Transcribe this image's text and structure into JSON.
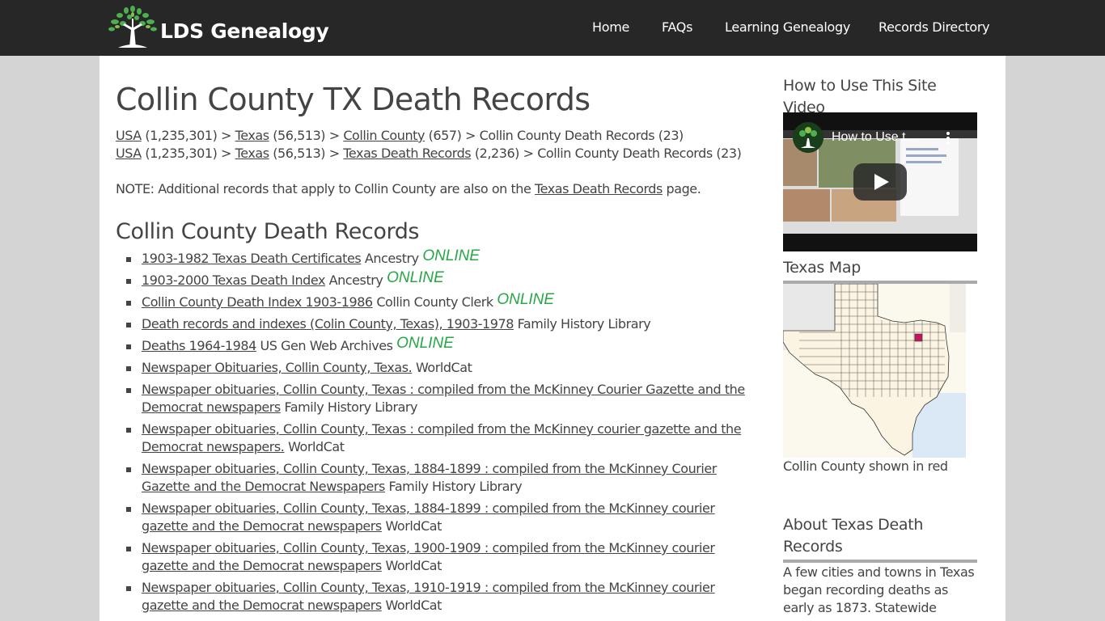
{
  "header": {
    "logo_text": "LDS Genealogy",
    "nav": [
      {
        "label": "Home"
      },
      {
        "label": "FAQs"
      },
      {
        "label": "Learning Genealogy"
      },
      {
        "label": "Records Directory"
      }
    ]
  },
  "main": {
    "title": "Collin County TX Death Records",
    "breadcrumbs": [
      [
        {
          "type": "link",
          "text": "USA"
        },
        {
          "type": "text",
          "text": " (1,235,301) > "
        },
        {
          "type": "link",
          "text": "Texas"
        },
        {
          "type": "text",
          "text": " (56,513) > "
        },
        {
          "type": "link",
          "text": "Collin County"
        },
        {
          "type": "text",
          "text": " (657) > Collin County Death Records (23)"
        }
      ],
      [
        {
          "type": "link",
          "text": "USA"
        },
        {
          "type": "text",
          "text": " (1,235,301) > "
        },
        {
          "type": "link",
          "text": "Texas"
        },
        {
          "type": "text",
          "text": " (56,513) > "
        },
        {
          "type": "link",
          "text": "Texas Death Records"
        },
        {
          "type": "text",
          "text": " (2,236) > Collin County Death Records (23)"
        }
      ]
    ],
    "note": {
      "prefix": "NOTE: Additional records that apply to Collin County are also on the ",
      "link": "Texas Death Records",
      "suffix": " page."
    },
    "section_title": "Collin County Death Records",
    "online_label": "ONLINE",
    "records": [
      {
        "title": "1903-1982 Texas Death Certificates",
        "source": "Ancestry",
        "online": true
      },
      {
        "title": "1903-2000 Texas Death Index",
        "source": "Ancestry",
        "online": true
      },
      {
        "title": "Collin County Death Index 1903-1986",
        "source": "Collin County Clerk",
        "online": true
      },
      {
        "title": "Death records and indexes (Colin County, Texas), 1903-1978",
        "source": "Family History Library",
        "online": false
      },
      {
        "title": "Deaths 1964-1984",
        "source": "US Gen Web Archives",
        "online": true
      },
      {
        "title": "Newspaper Obituaries, Collin County, Texas.",
        "source": "WorldCat",
        "online": false
      },
      {
        "title": "Newspaper obituaries, Collin County, Texas : compiled from the McKinney Courier Gazette and the Democrat newspapers",
        "source": "Family History Library",
        "online": false
      },
      {
        "title": "Newspaper obituaries, Collin County, Texas : compiled from the McKinney courier gazette and the Democrat newspapers.",
        "source": "WorldCat",
        "online": false
      },
      {
        "title": "Newspaper obituaries, Collin County, Texas, 1884-1899 : compiled from the McKinney Courier Gazette and the Democrat Newspapers",
        "source": "Family History Library",
        "online": false
      },
      {
        "title": "Newspaper obituaries, Collin County, Texas, 1884-1899 : compiled from the McKinney courier gazette and the Democrat newspapers",
        "source": "WorldCat",
        "online": false
      },
      {
        "title": "Newspaper obituaries, Collin County, Texas, 1900-1909 : compiled from the McKinney courier gazette and the Democrat newspapers",
        "source": "WorldCat",
        "online": false
      },
      {
        "title": "Newspaper obituaries, Collin County, Texas, 1910-1919 : compiled from the McKinney courier gazette and the Democrat newspapers",
        "source": "WorldCat",
        "online": false
      }
    ]
  },
  "sidebar": {
    "video_heading": "How to Use This Site Video",
    "video_title": "How to Use t...",
    "map_heading": "Texas Map",
    "map_caption": "Collin County shown in red",
    "about_heading": "About Texas Death Records",
    "about_text": "A few cities and towns in Texas began recording deaths as early as 1873. Statewide"
  },
  "colors": {
    "header_bg": "#272727",
    "page_bg": "#d4d4d4",
    "online": "#28a745",
    "highlight_county": "#c2185b"
  }
}
